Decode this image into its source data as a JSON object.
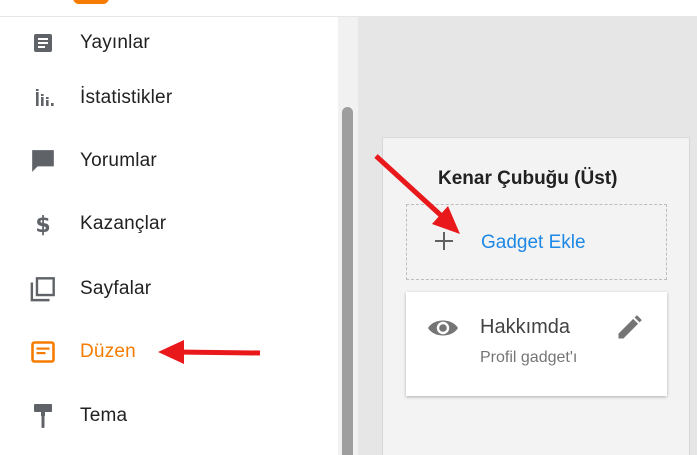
{
  "colors": {
    "accent": "#f57c00",
    "link": "#1e88e5",
    "annotation_arrow": "#e8181b",
    "icon_gray": "#5f6368"
  },
  "sidebar": {
    "items": [
      {
        "label": "Yayınlar",
        "icon": "posts-icon"
      },
      {
        "label": "İstatistikler",
        "icon": "stats-icon"
      },
      {
        "label": "Yorumlar",
        "icon": "comments-icon"
      },
      {
        "label": "Kazançlar",
        "icon": "dollar-icon"
      },
      {
        "label": "Sayfalar",
        "icon": "pages-icon"
      },
      {
        "label": "Düzen",
        "icon": "layout-icon",
        "active": true
      },
      {
        "label": "Tema",
        "icon": "theme-paint-roller-icon"
      }
    ]
  },
  "panel": {
    "title": "Kenar Çubuğu (Üst)",
    "add_label": "Gadget Ekle",
    "gadget": {
      "title": "Hakkımda",
      "subtitle": "Profil gadget'ı"
    }
  }
}
